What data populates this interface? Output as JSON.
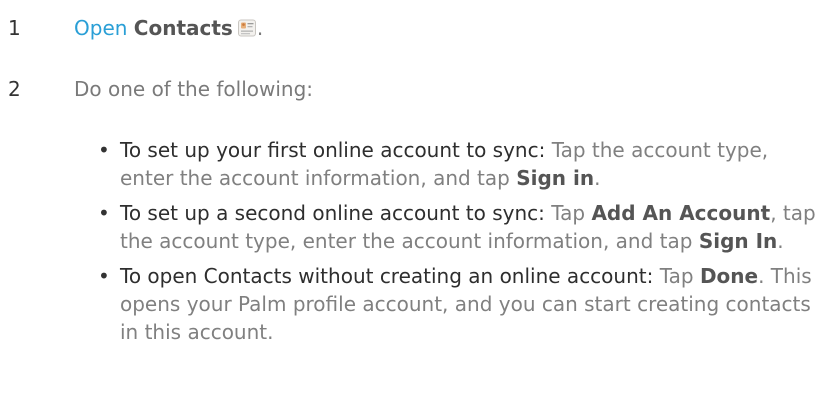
{
  "steps": [
    {
      "number": "1",
      "link_text": "Open",
      "app_name": "Contacts",
      "icon": "contacts-app-icon",
      "end_punct": "."
    },
    {
      "number": "2",
      "text": "Do one of the following:"
    }
  ],
  "options": [
    {
      "lead": "To set up your first online account to sync:",
      "t1": " Tap the account type, enter the account information, and tap ",
      "b1": "Sign in",
      "t2": "."
    },
    {
      "lead": "To set up a second online account to sync:",
      "t1": " Tap ",
      "b1": "Add An Account",
      "t2": ", tap the account type, enter the account information, and tap ",
      "b2": "Sign In",
      "t3": "."
    },
    {
      "lead": "To open Contacts without creating an online account:",
      "t1": " Tap ",
      "b1": "Done",
      "t2": ". This opens your Palm profile account, and you can start creating contacts in this account."
    }
  ],
  "colors": {
    "link": "#2a9fd6",
    "body_text": "#808080",
    "lead_text": "#2e2e2e"
  }
}
